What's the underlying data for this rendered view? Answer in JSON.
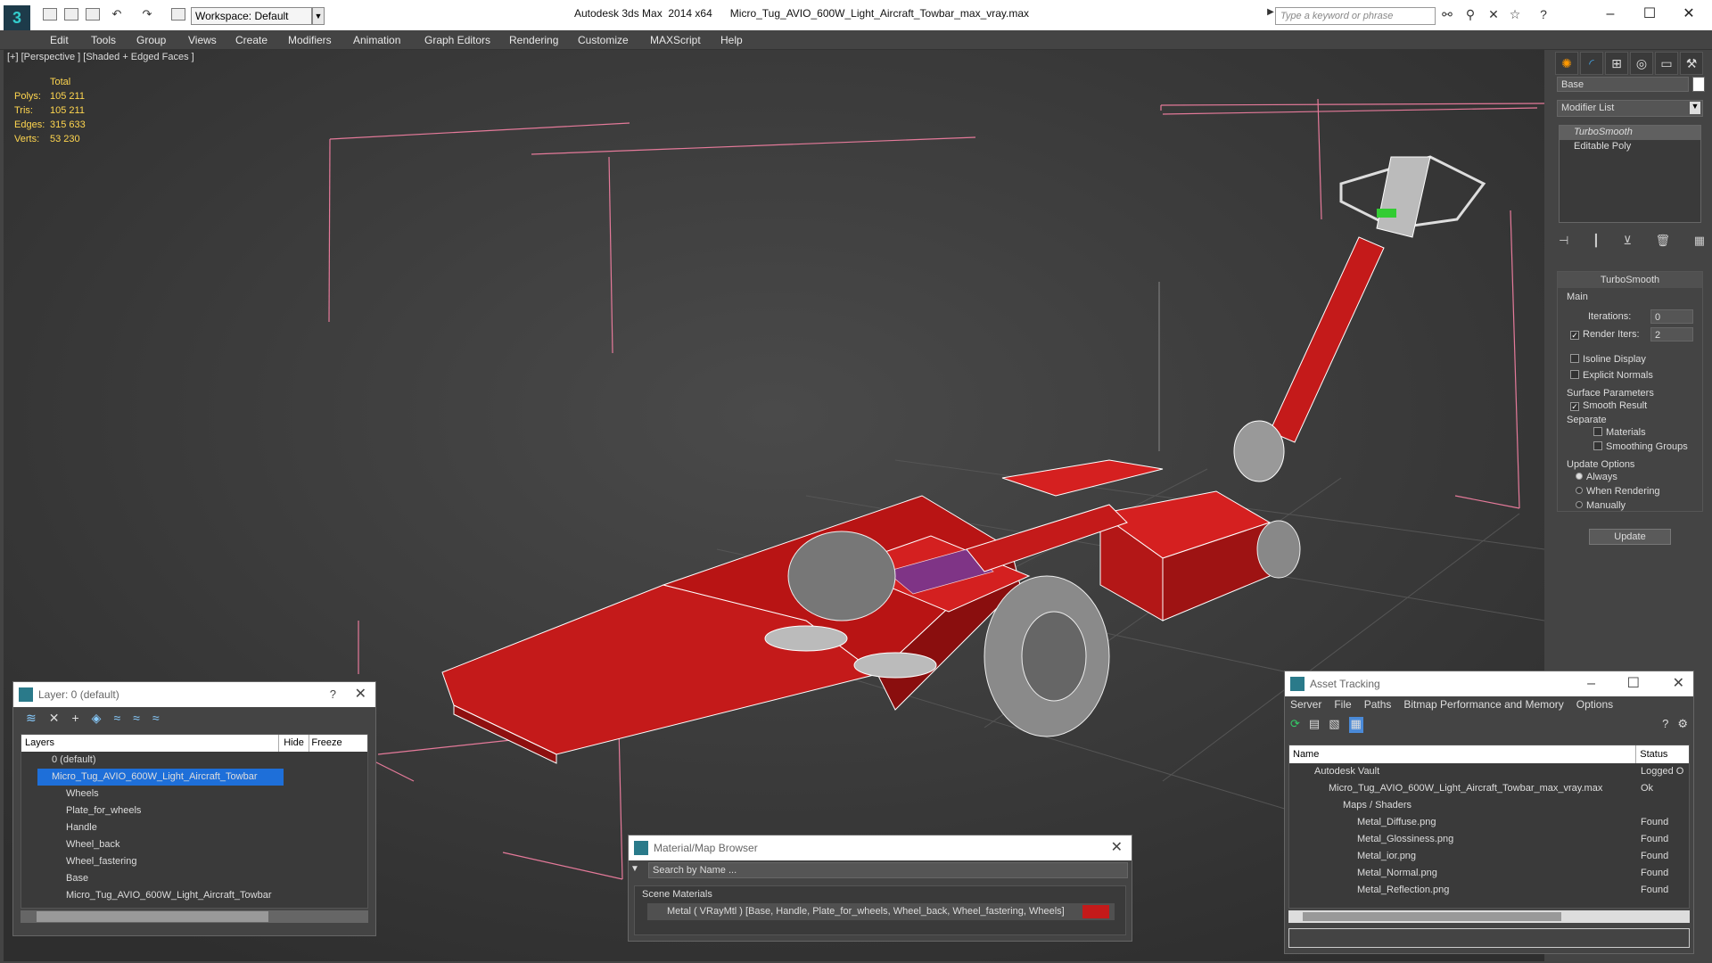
{
  "app": {
    "title": "Autodesk 3ds Max  2014 x64",
    "file": "Micro_Tug_AVIO_600W_Light_Aircraft_Towbar_max_vray.max",
    "workspace": "Workspace: Default",
    "search_placeholder": "Type a keyword or phrase"
  },
  "menu": [
    "Edit",
    "Tools",
    "Group",
    "Views",
    "Create",
    "Modifiers",
    "Animation",
    "Graph Editors",
    "Rendering",
    "Customize",
    "MAXScript",
    "Help"
  ],
  "viewport": {
    "label": "[+] [Perspective ] [Shaded + Edged Faces ]",
    "stats": {
      "header": "Total",
      "rows": [
        {
          "k": "Polys:",
          "v": "105 211"
        },
        {
          "k": "Tris:",
          "v": "105 211"
        },
        {
          "k": "Edges:",
          "v": "315 633"
        },
        {
          "k": "Verts:",
          "v": "53 230"
        }
      ]
    }
  },
  "command_panel": {
    "object_name": "Base",
    "modifier_list": "Modifier List",
    "stack": [
      "TurboSmooth",
      "Editable Poly"
    ],
    "turbosmooth": {
      "title": "TurboSmooth",
      "main": "Main",
      "iterations_label": "Iterations:",
      "iterations": "0",
      "render_iters_label": "Render Iters:",
      "render_iters": "2",
      "isoline": "Isoline Display",
      "explicit": "Explicit Normals",
      "surface": "Surface Parameters",
      "smooth": "Smooth Result",
      "separate": "Separate",
      "materials": "Materials",
      "smoothing": "Smoothing Groups",
      "update_options": "Update Options",
      "always": "Always",
      "when_rendering": "When Rendering",
      "manually": "Manually",
      "update_btn": "Update"
    }
  },
  "layer_panel": {
    "title": "Layer: 0 (default)",
    "cols": [
      "Layers",
      "Hide",
      "Freeze"
    ],
    "rows": [
      "0 (default)",
      "Micro_Tug_AVIO_600W_Light_Aircraft_Towbar",
      "Wheels",
      "Plate_for_wheels",
      "Handle",
      "Wheel_back",
      "Wheel_fastering",
      "Base",
      "Micro_Tug_AVIO_600W_Light_Aircraft_Towbar"
    ]
  },
  "material_browser": {
    "title": "Material/Map Browser",
    "search": "Search by Name ...",
    "section": "Scene Materials",
    "item": "Metal  ( VRayMtl ) [Base, Handle, Plate_for_wheels, Wheel_back, Wheel_fastering, Wheels]"
  },
  "asset_tracking": {
    "title": "Asset Tracking",
    "menu": [
      "Server",
      "File",
      "Paths",
      "Bitmap Performance and Memory",
      "Options"
    ],
    "cols": [
      "Name",
      "Status"
    ],
    "rows": [
      {
        "name": "Autodesk Vault",
        "status": "Logged O"
      },
      {
        "name": "Micro_Tug_AVIO_600W_Light_Aircraft_Towbar_max_vray.max",
        "status": "Ok"
      },
      {
        "name": "Maps / Shaders",
        "status": ""
      },
      {
        "name": "Metal_Diffuse.png",
        "status": "Found"
      },
      {
        "name": "Metal_Glossiness.png",
        "status": "Found"
      },
      {
        "name": "Metal_ior.png",
        "status": "Found"
      },
      {
        "name": "Metal_Normal.png",
        "status": "Found"
      },
      {
        "name": "Metal_Reflection.png",
        "status": "Found"
      }
    ]
  }
}
